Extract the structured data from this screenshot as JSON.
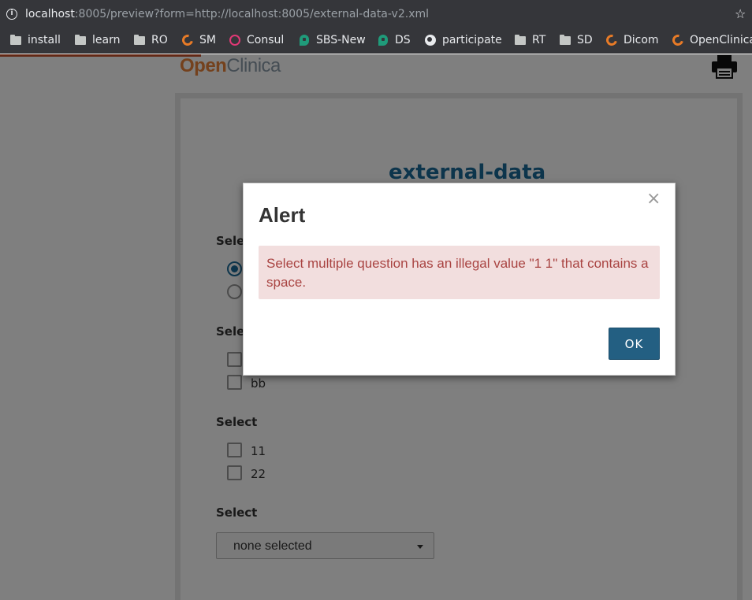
{
  "browser": {
    "url_host": "localhost",
    "url_rest": ":8005/preview?form=http://localhost:8005/external-data-v2.xml",
    "bookmarks": [
      {
        "label": "install",
        "icon": "folder-icon"
      },
      {
        "label": "learn",
        "icon": "folder-icon"
      },
      {
        "label": "RO",
        "icon": "folder-icon"
      },
      {
        "label": "SM",
        "icon": "openclinica-icon"
      },
      {
        "label": "Consul",
        "icon": "consul-icon"
      },
      {
        "label": "SBS-New",
        "icon": "meet-icon"
      },
      {
        "label": "DS",
        "icon": "meet-icon"
      },
      {
        "label": "participate",
        "icon": "globe-icon"
      },
      {
        "label": "RT",
        "icon": "folder-icon"
      },
      {
        "label": "SD",
        "icon": "folder-icon"
      },
      {
        "label": "Dicom",
        "icon": "openclinica-icon"
      },
      {
        "label": "OpenClinica",
        "icon": "openclinica-icon"
      }
    ]
  },
  "header": {
    "logo_open": "Open",
    "logo_clinica": "Clinica"
  },
  "form": {
    "title": "external-data",
    "q1_label": "Selec",
    "q2_label": "Selec",
    "q2_options": [
      "",
      "bb"
    ],
    "q3_label": "Select",
    "q3_options": [
      "11",
      "22"
    ],
    "q4_label": "Select",
    "q4_select_value": "none selected"
  },
  "modal": {
    "title": "Alert",
    "close_glyph": "×",
    "message": "Select multiple question has an illegal value \"1 1\" that contains a space.",
    "ok_label": "OK"
  },
  "colors": {
    "brand_blue": "#1b6a99",
    "button_blue": "#235f82",
    "alert_bg": "#f2dede",
    "alert_text": "#a94442"
  }
}
